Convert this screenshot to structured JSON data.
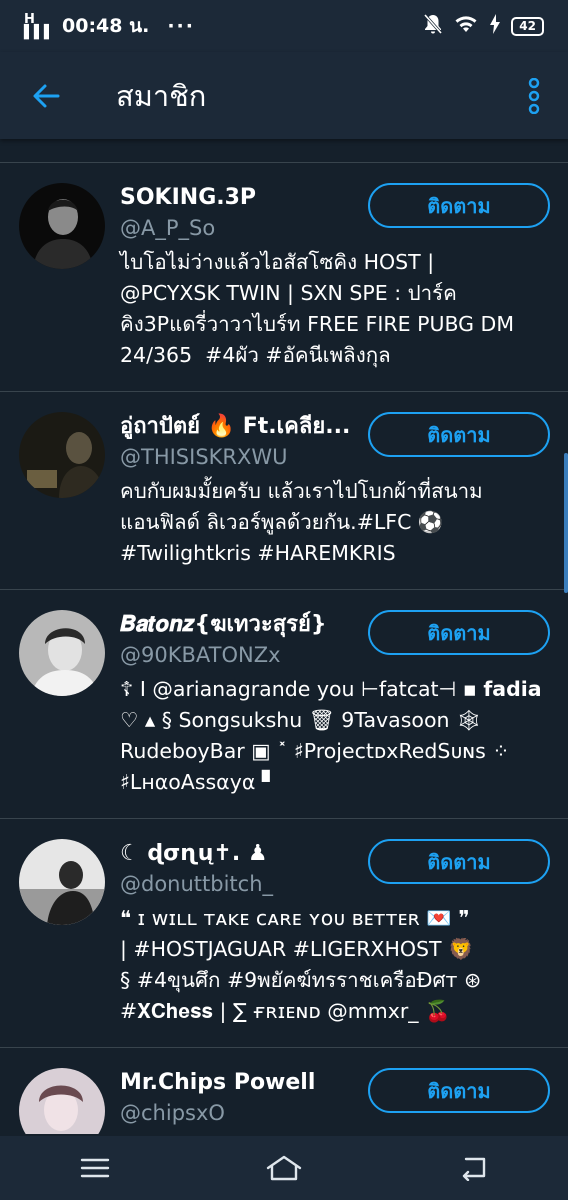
{
  "status_bar": {
    "signal": "H‍",
    "time": "00:48 น.",
    "dots": "···",
    "battery": "42"
  },
  "app_bar": {
    "title": "สมาชิก"
  },
  "members": [
    {
      "name": "SOKING.3P",
      "handle": "@A_P_So",
      "follow_label": "ติดตาม",
      "bio": "ไบโอไม่ว่างแล้วไอสัสโซคิง HOST |\n@PCYXSK TWIN | SXN SPE : ปาร์ค\nคิง3Pแดรี่วาวาไบร์ท FREE FIRE PUBG DM\n24/365  #4ผัว #อัคนีเพลิงกุล"
    },
    {
      "name": "อู่ถาปัตย์ 🔥 Ft.เคลีย...",
      "handle": "@THISISKRXWU",
      "follow_label": "ติดตาม",
      "bio": "คบกับผมมั้ยครับ แล้วเราไปโบกผ้าที่สนาม\nแอนฟิลด์ ลิเวอร์พูลด้วยกัน.#LFC ⚽\n#Twilightkris #HAREMKRIS"
    },
    {
      "name": "𝑩𝒂𝒕𝒐𝒏𝒛{ฆเทวะสุรย์}",
      "handle": "@90KBATONZx",
      "follow_label": "ติดตาม",
      "bio": "☦ I @arianagrande you ⊢fatcat⊣ ▪ 𝗳𝗮𝗱𝗶𝗮\n♡ ▴ § Songsukshu 🗑 9Tavasoon 🕸\nRudeboyBar ▣ ˟ ♯Projectᴅ𝗑RedSᴜɴs ⁘\n♯LнαoAssαyα ▘"
    },
    {
      "name": "☾ ɖσɳų✝. ♟",
      "handle": "@donuttbitch_",
      "follow_label": "ติดตาม",
      "bio": "❝ ɪ ᴡɪʟʟ ᴛᴀᴋᴇ ᴄᴀʀᴇ ʏᴏᴜ ʙᴇᴛᴛᴇʀ 💌 ❞\n| #HOSTJAGUAR #LIGERXHOST 🦁\n§ #4ขุนศึก #9พยัคฆ์ทรราชเครือÐศт ⊛\n#𝐗𝐂𝐡𝐞𝐬𝐬 | ∑ ғʀɪᴇɴᴅ @mmxr_ 🍒"
    },
    {
      "name": "Mr.Chips Powell",
      "handle": "@chipsxO",
      "follow_label": "ติดตาม",
      "bio": ""
    }
  ],
  "colors": {
    "background": "#15202b",
    "bar": "#1c2938",
    "accent": "#1da1f2",
    "secondary_text": "#8899a6",
    "divider": "#38444d"
  },
  "icons": {
    "back": "arrow-left-icon",
    "overflow": "more-vertical-icon",
    "nav_recent": "menu-icon",
    "nav_home": "home-icon",
    "nav_back": "back-icon"
  }
}
